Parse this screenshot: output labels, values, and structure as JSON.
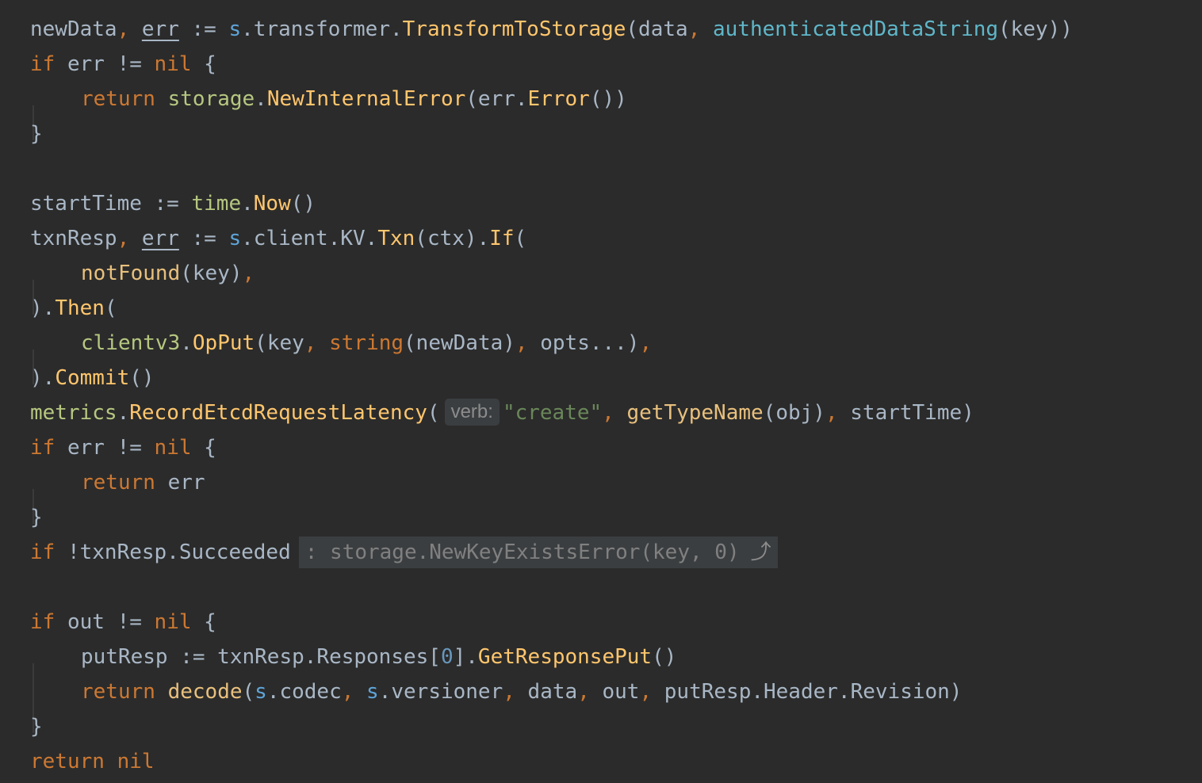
{
  "editor": {
    "theme_background": "#2b2b2b",
    "code": {
      "l1": {
        "newData": "newData",
        "err": "err",
        "op": " := ",
        "s": "s",
        "transformer": ".transformer.",
        "transformToStorage": "TransformToStorage",
        "args_open": "(data",
        "authFn": "authenticatedDataString",
        "args_close": "(key))"
      },
      "l2": {
        "if": "if",
        "cond": " err != ",
        "nil": "nil",
        "brace": " {"
      },
      "l3": {
        "return": "return",
        "storage": "storage",
        "dot": ".",
        "newInternalError": "NewInternalError",
        "open": "(err.",
        "error": "Error",
        "close": "())"
      },
      "l4": {
        "brace": "}"
      },
      "l6": {
        "startTime": "startTime := ",
        "time": "time",
        "dot": ".",
        "now": "Now",
        "parens": "()"
      },
      "l7": {
        "txnResp": "txnResp",
        "err": "err",
        "op": " := ",
        "s": "s",
        "client": ".client.KV.",
        "txn": "Txn",
        "ctx": "(ctx).",
        "if": "If",
        "open": "("
      },
      "l8": {
        "notFound": "notFound",
        "args": "(key)"
      },
      "l9": {
        "close": ").",
        "then": "Then",
        "open": "("
      },
      "l10": {
        "clientv3": "clientv3",
        "dot": ".",
        "opPut": "OpPut",
        "key": "(key",
        "string": "string",
        "newData": "(newData)",
        "opts": " opts...)"
      },
      "l11": {
        "close": ").",
        "commit": "Commit",
        "parens": "()"
      },
      "l12": {
        "metrics": "metrics",
        "dot": ".",
        "record": "RecordEtcdRequestLatency",
        "open": "(",
        "hint": "verb:",
        "create": "\"create\"",
        "getTypeName": "getTypeName",
        "obj": "(obj)",
        "startTime": " startTime)"
      },
      "l13": {
        "if": "if",
        "cond": " err != ",
        "nil": "nil",
        "brace": " {"
      },
      "l14": {
        "return": "return",
        "err": " err"
      },
      "l15": {
        "brace": "}"
      },
      "l16": {
        "if": "if",
        "cond": " !txnResp.Succeeded",
        "fold": ": storage.NewKeyExistsError(key, 0)",
        "fold_icon": "⤴"
      },
      "l18": {
        "if": "if",
        "cond": " out != ",
        "nil": "nil",
        "brace": " {"
      },
      "l19": {
        "putResp": "putResp := txnResp.Responses[",
        "zero": "0",
        "close": "].",
        "getResponsePut": "GetResponsePut",
        "parens": "()"
      },
      "l20": {
        "return": "return",
        "decode": "decode",
        "open": "(",
        "s1": "s",
        "codec": ".codec",
        "s2": "s",
        "versioner": ".versioner",
        "data": " data",
        "out": " out",
        "rest": " putResp.Header.Revision)"
      },
      "l21": {
        "brace": "}"
      },
      "l22": {
        "return": "return",
        "nil": "nil"
      },
      "comma": ","
    }
  }
}
